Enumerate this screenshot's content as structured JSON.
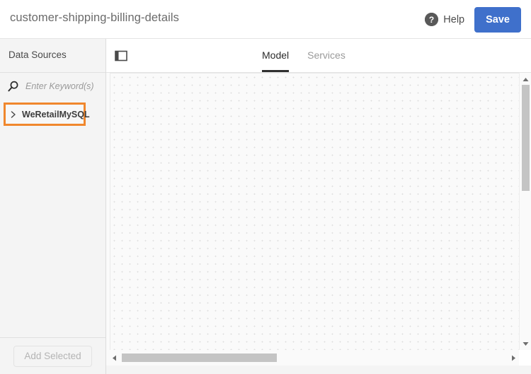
{
  "header": {
    "title": "customer-shipping-billing-details",
    "help_label": "Help",
    "help_icon": "question-circle-icon",
    "save_label": "Save",
    "save_color": "#3f70cb"
  },
  "sidebar": {
    "title": "Data Sources",
    "search": {
      "icon": "search-icon",
      "placeholder": "Enter Keyword(s)",
      "value": ""
    },
    "tree": [
      {
        "label": "WeRetailMySQL",
        "expand_icon": "chevron-right-icon",
        "selected": true,
        "highlight_color": "#f0872d"
      }
    ],
    "footer": {
      "add_selected_label": "Add Selected",
      "disabled": true
    }
  },
  "main": {
    "panel_toggle_icon": "panel-toggle-icon",
    "tabs": [
      {
        "label": "Model",
        "active": true
      },
      {
        "label": "Services",
        "active": false
      }
    ],
    "canvas": {
      "grid": "dot-grid",
      "empty": true
    },
    "scrollbars": {
      "vertical": {
        "up_icon": "caret-up-icon",
        "down_icon": "caret-down-icon"
      },
      "horizontal": {
        "left_icon": "caret-left-icon",
        "right_icon": "caret-right-icon"
      }
    }
  }
}
